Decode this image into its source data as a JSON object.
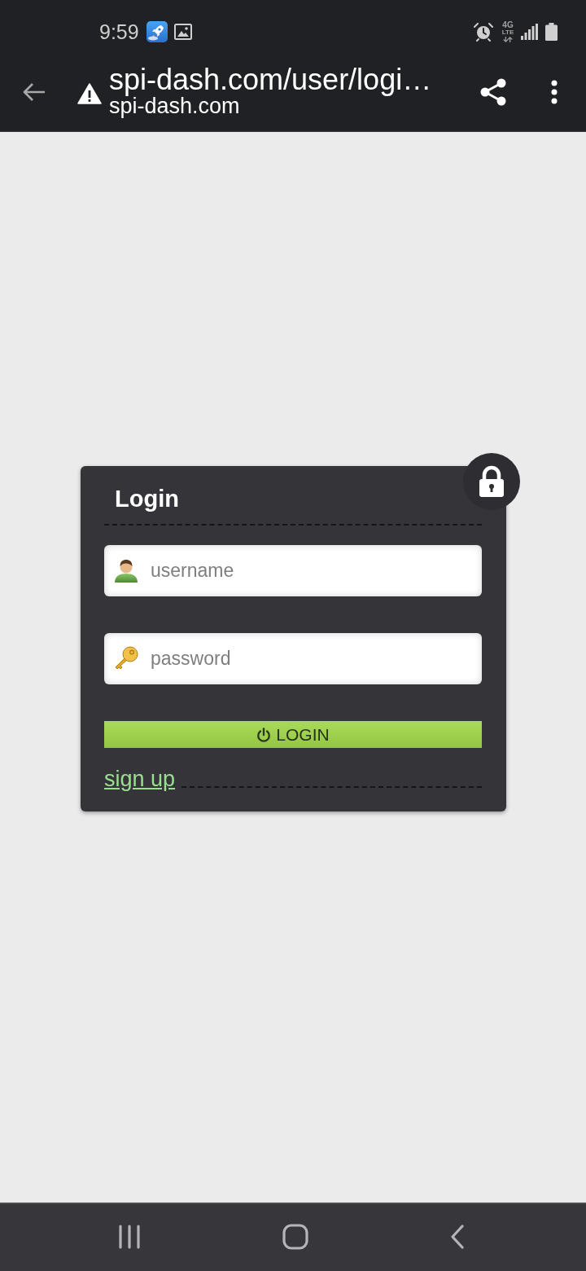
{
  "status_bar": {
    "time": "9:59",
    "network": {
      "generation": "4G",
      "technology": "LTE"
    }
  },
  "browser_bar": {
    "url": "spi-dash.com/user/logi…",
    "domain": "spi-dash.com"
  },
  "login_card": {
    "title": "Login",
    "fields": [
      {
        "kind": "username",
        "placeholder": "username"
      },
      {
        "kind": "password",
        "placeholder": "password"
      }
    ],
    "login_button": "LOGIN",
    "signup_link": "sign up"
  }
}
